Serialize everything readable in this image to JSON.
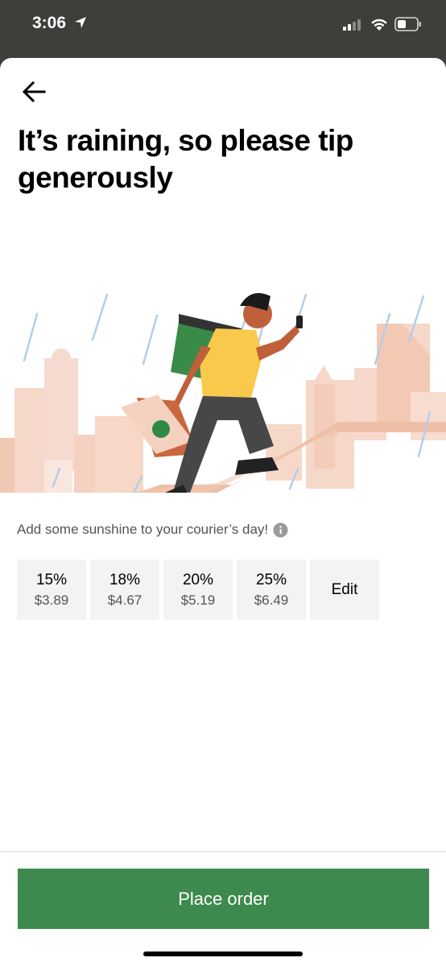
{
  "status_bar": {
    "time": "3:06",
    "icons": [
      "location-arrow-icon",
      "cellular-signal-icon",
      "wifi-icon",
      "battery-icon"
    ]
  },
  "header": {
    "back_icon": "back-arrow-icon",
    "title": "It’s raining, so please tip generously"
  },
  "illustration": {
    "description_icon": "courier-in-rain-illustration"
  },
  "tip": {
    "subtitle": "Add some sunshine to your courier’s day!",
    "info_icon": "info-icon",
    "options": [
      {
        "percent": "15%",
        "amount": "$3.89"
      },
      {
        "percent": "18%",
        "amount": "$4.67"
      },
      {
        "percent": "20%",
        "amount": "$5.19"
      },
      {
        "percent": "25%",
        "amount": "$6.49"
      }
    ],
    "edit_label": "Edit"
  },
  "footer": {
    "place_order_label": "Place order"
  },
  "colors": {
    "accent_green": "#3e8a4e",
    "status_bar_bg": "#3e3e3b",
    "tile_bg": "#f3f3f3"
  }
}
